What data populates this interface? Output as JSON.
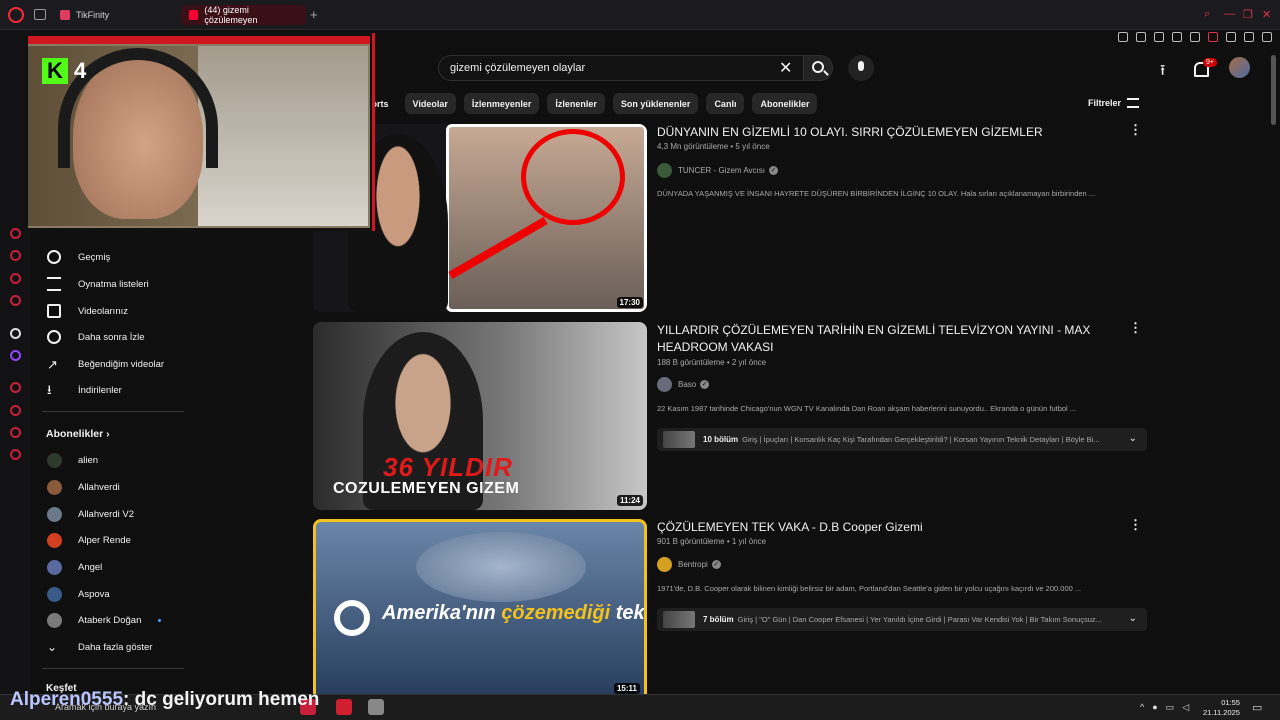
{
  "browser": {
    "tabs": [
      {
        "label": "TikFinity"
      },
      {
        "label": "(44) gizemi çözülemeyen"
      }
    ],
    "new_tab": "+"
  },
  "search": {
    "query": "gizemi çözülemeyen olaylar",
    "clear": "✕"
  },
  "header": {
    "notifications_badge": "9+",
    "upload_glyph": "⭱"
  },
  "chips": [
    "horts",
    "Videolar",
    "İzlenmeyenler",
    "İzlenenler",
    "Son yüklenenler",
    "Canlı",
    "Abonelikler"
  ],
  "filters_label": "Filtreler",
  "webcam": {
    "kick_logo": "K",
    "kick_number": "4"
  },
  "sidebar": {
    "items": [
      {
        "label": "Geçmiş",
        "icon": "history-icon"
      },
      {
        "label": "Oynatma listeleri",
        "icon": "playlist-icon"
      },
      {
        "label": "Videolarınız",
        "icon": "your-videos-icon"
      },
      {
        "label": "Daha sonra İzle",
        "icon": "watch-later-icon"
      },
      {
        "label": "Beğendiğim videolar",
        "icon": "like-icon"
      },
      {
        "label": "İndirilenler",
        "icon": "download-icon"
      }
    ],
    "subscriptions_header": "Abonelikler",
    "subscriptions": [
      {
        "name": "alien",
        "color": "#2f3a2f"
      },
      {
        "name": "Allahverdi",
        "color": "#8a5a3a"
      },
      {
        "name": "Allahverdi V2",
        "color": "#6a7a8a"
      },
      {
        "name": "Alper Rende",
        "color": "#d04020"
      },
      {
        "name": "Angel",
        "color": "#5a6aa0"
      },
      {
        "name": "Aspova",
        "color": "#3a5a8a"
      },
      {
        "name": "Ataberk Doğan",
        "color": "#7a7a7a"
      }
    ],
    "show_more": "Daha fazla göster",
    "explore_header": "Keşfet"
  },
  "results": [
    {
      "title": "DÜNYANIN EN GİZEMLİ 10 OLAYI. SIRRI ÇÖZÜLEMEYEN GİZEMLER",
      "meta": "4,3 Mn görüntüleme • 5 yıl önce",
      "channel": "TUNCER - Gizem Avcısı",
      "channel_color": "#3a5a3a",
      "description": "DÜNYADA YAŞANMIŞ VE İNSANI HAYRETE DÜŞÜREN BİRBİRİNDEN İLGİNÇ 10 OLAY. Hala sırları açıklanamayan birbirinden ...",
      "duration": "17:30"
    },
    {
      "title": "YILLARDIR ÇÖZÜLEMEYEN TARİHİN EN GİZEMLİ TELEVİZYON YAYINI - MAX HEADROOM VAKASI",
      "meta": "188 B görüntüleme • 2 yıl önce",
      "channel": "Baso",
      "channel_color": "#6a6a7a",
      "description": "22 Kasım 1987 tarihinde Chicago'nun WGN TV Kanalında Dan Roan akşam haberlerini sunuyordu.. Ekranda o günün futbol ...",
      "duration": "11:24",
      "thumb_red": "36 YILDIR",
      "thumb_white": "COZULEMEYEN GIZEM",
      "chapters_count": "10 bölüm",
      "chapters_text": "Giriş | İpuçları | Korsanlık Kaç Kişi Tarafından Gerçekleştirildi? | Korsan Yayının Teknik Detayları | Böyle Bi..."
    },
    {
      "title": "ÇÖZÜLEMEYEN TEK VAKA - D.B Cooper Gizemi",
      "meta": "901 B görüntüleme • 1 yıl önce",
      "channel": "Bentropi",
      "channel_color": "#d4a020",
      "description": "1971'de, D.B. Cooper olarak bilinen kimliği belirsiz bir adam, Portland'dan Seattle'a giden bir yolcu uçağını kaçırdı ve 200.000 ...",
      "duration": "15:11",
      "thumb_text_a": "Amerika'nın ",
      "thumb_text_b": "çözemediği",
      "thumb_text_c": " tek dava",
      "chapters_count": "7 bölüm",
      "chapters_text": "Giriş | \"O\" Gün | Dan Cooper Efsanesi | Yer Yanıldı İçine Girdi | Parası Var Kendisi Yok | Bir Takım Sonuçsuz..."
    }
  ],
  "chat_overlay": {
    "user": "Alperen0555",
    "message": ": dc geliyorum hemen"
  },
  "taskbar": {
    "search_placeholder": "Aramak için buraya yazın",
    "time": "01:55",
    "date": "21.11.2025"
  }
}
